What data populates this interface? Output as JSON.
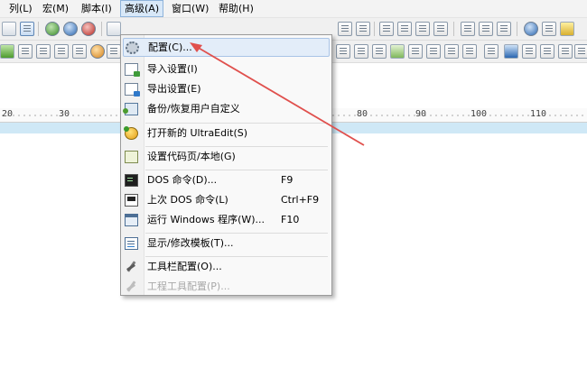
{
  "menubar": {
    "items": [
      {
        "label": "列(L)"
      },
      {
        "label": "宏(M)"
      },
      {
        "label": "脚本(I)"
      },
      {
        "label": "高级(A)"
      },
      {
        "label": "窗口(W)"
      },
      {
        "label": "帮助(H)"
      }
    ]
  },
  "ruler": {
    "labels": [
      "20",
      "30",
      "80",
      "90",
      "100",
      "110"
    ]
  },
  "advanced_menu": {
    "items": [
      {
        "label": "配置(C)...",
        "shortcut": "",
        "icon": "gear-icon"
      },
      {
        "label": "导入设置(I)",
        "shortcut": "",
        "icon": "import-settings-icon"
      },
      {
        "label": "导出设置(E)",
        "shortcut": "",
        "icon": "export-settings-icon"
      },
      {
        "label": "备份/恢复用户自定义",
        "shortcut": "",
        "icon": "backup-icon"
      },
      {
        "label": "打开新的 UltraEdit(S)",
        "shortcut": "",
        "icon": "ultraedit-icon"
      },
      {
        "label": "设置代码页/本地(G)",
        "shortcut": "",
        "icon": "codepage-icon"
      },
      {
        "label": "DOS 命令(D)...",
        "shortcut": "F9",
        "icon": "dos-command-icon"
      },
      {
        "label": "上次 DOS 命令(L)",
        "shortcut": "Ctrl+F9",
        "icon": "last-dos-command-icon"
      },
      {
        "label": "运行 Windows 程序(W)...",
        "shortcut": "F10",
        "icon": "run-windows-program-icon"
      },
      {
        "label": "显示/修改模板(T)...",
        "shortcut": "",
        "icon": "template-icon"
      },
      {
        "label": "工具栏配置(O)...",
        "shortcut": "",
        "icon": "tools-icon"
      },
      {
        "label": "工程工具配置(P)...",
        "shortcut": "",
        "icon": "project-tools-icon",
        "disabled": true
      }
    ]
  },
  "colors": {
    "arrow": "#e0504d",
    "highlight": "#e3edf9",
    "ruler_band": "#cfe8f6"
  }
}
